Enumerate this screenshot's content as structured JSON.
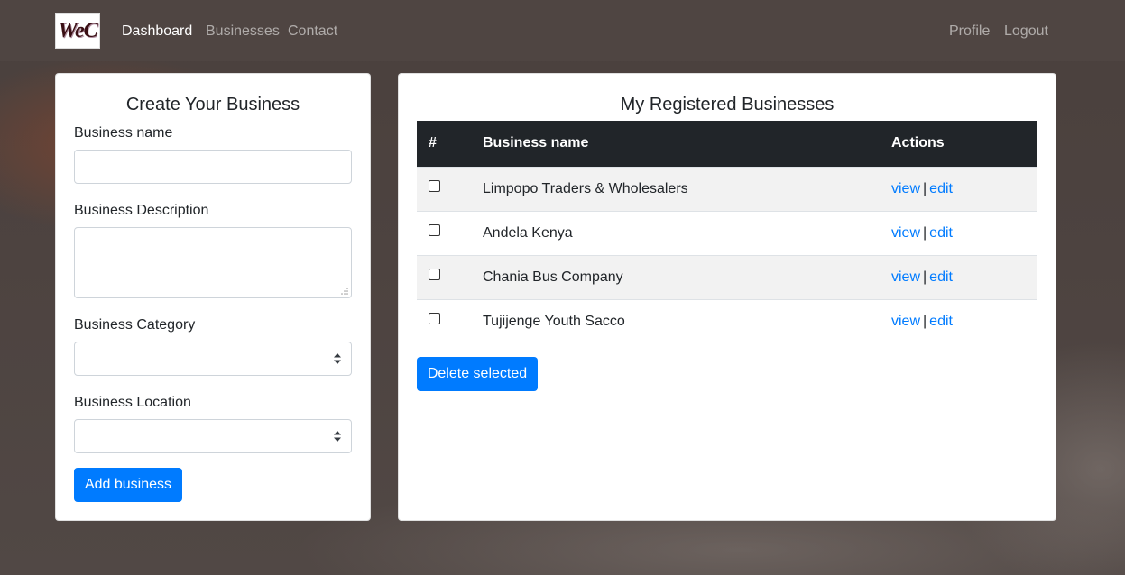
{
  "nav": {
    "logo_text": "WeC",
    "links": [
      {
        "label": "Dashboard"
      },
      {
        "label": "Businesses"
      },
      {
        "label": "Contact"
      }
    ],
    "right_links": [
      {
        "label": "Profile"
      },
      {
        "label": "Logout"
      }
    ]
  },
  "create_form": {
    "title": "Create Your Business",
    "name_label": "Business name",
    "name_value": "",
    "description_label": "Business Description",
    "description_value": "",
    "category_label": "Business Category",
    "category_value": "",
    "location_label": "Business Location",
    "location_value": "",
    "submit_label": "Add business"
  },
  "businesses": {
    "title": "My Registered Businesses",
    "columns": [
      "#",
      "Business name",
      "Actions"
    ],
    "rows": [
      {
        "name": "Limpopo Traders & Wholesalers",
        "view": "view",
        "sep": "|",
        "edit": "edit"
      },
      {
        "name": "Andela Kenya",
        "view": "view",
        "sep": "|",
        "edit": "edit"
      },
      {
        "name": "Chania Bus Company",
        "view": "view",
        "sep": "|",
        "edit": "edit"
      },
      {
        "name": "Tujijenge Youth Sacco",
        "view": "view",
        "sep": "|",
        "edit": "edit"
      }
    ],
    "delete_label": "Delete selected"
  },
  "colors": {
    "accent": "#007bff",
    "table_header": "#212529",
    "navbar": "#4f4542"
  }
}
